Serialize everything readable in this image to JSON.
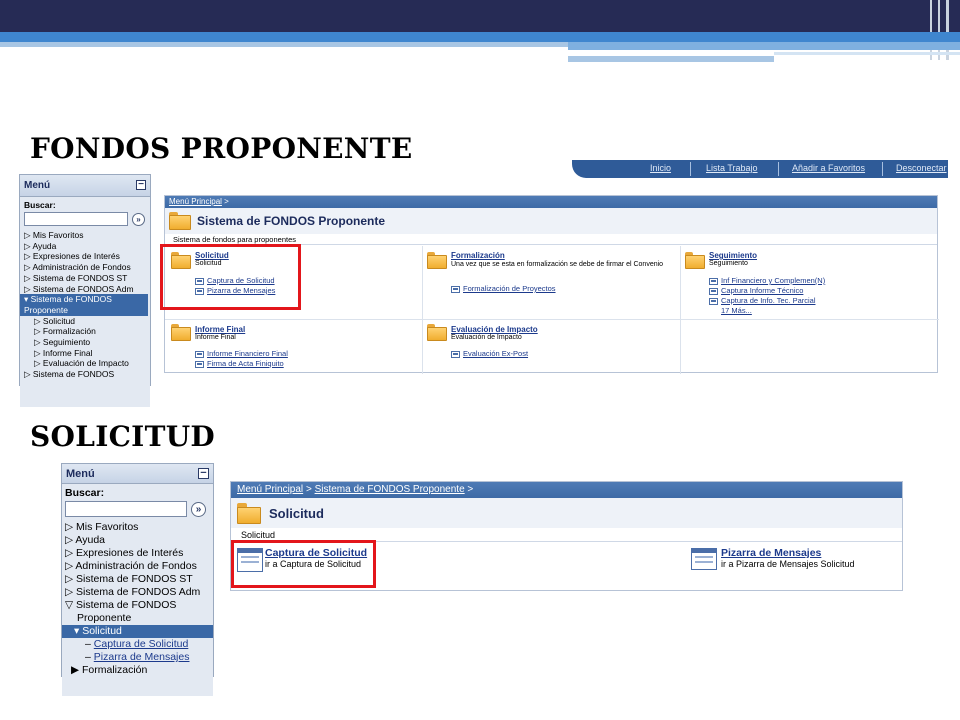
{
  "slide": {
    "heading_1": "FONDOS PROPONENTE",
    "heading_2": "SOLICITUD"
  },
  "colors": {
    "top_bar": "#262b55",
    "accent_blue": "#3f86cf",
    "highlight_red": "#e3161b",
    "menu_active": "#3a68a6",
    "breadcrumb": "#4f7bb5"
  },
  "screen1": {
    "header_links": [
      "Inicio",
      "Lista Trabajo",
      "Añadir a Favoritos",
      "Desconectar"
    ],
    "menu": {
      "title": "Menú",
      "search_label": "Buscar:",
      "search_value": "",
      "items": [
        {
          "label": "Mis Favoritos"
        },
        {
          "label": "Ayuda"
        },
        {
          "label": "Expresiones de Interés"
        },
        {
          "label": "Administración de Fondos"
        },
        {
          "label": "Sistema de FONDOS ST"
        },
        {
          "label": "Sistema de FONDOS Adm"
        },
        {
          "label": "Sistema de FONDOS Proponente"
        },
        {
          "label": "Solicitud"
        },
        {
          "label": "Formalización"
        },
        {
          "label": "Seguimiento"
        },
        {
          "label": "Informe Final"
        },
        {
          "label": "Evaluación de Impacto"
        },
        {
          "label": "Sistema de FONDOS"
        }
      ]
    },
    "breadcrumb": {
      "root": "Menú Principal",
      "sep": ">"
    },
    "title": "Sistema de FONDOS Proponente",
    "description": "Sistema de fondos para proponentes",
    "cells": [
      {
        "title": "Solicitud",
        "subtitle": "Solicitud",
        "links": [
          "Captura de Solicitud",
          "Pizarra de Mensajes"
        ]
      },
      {
        "title": "Formalización",
        "subtitle": "Una vez que se esta en formalización se debe de firmar el Convenio",
        "links": [
          "Formalización de Proyectos"
        ]
      },
      {
        "title": "Seguimiento",
        "subtitle": "Seguimiento",
        "links": [
          "Inf Financiero y Complemen(N)",
          "Captura Informe Técnico",
          "Captura de Info. Tec. Parcial"
        ],
        "more": "17 Más..."
      },
      {
        "title": "Informe Final",
        "subtitle": "Informe Final",
        "links": [
          "Informe Financiero Final",
          "Firma de Acta Finiquito"
        ]
      },
      {
        "title": "Evaluación de Impacto",
        "subtitle": "Evaluación de Impacto",
        "links": [
          "Evaluación Ex-Post"
        ]
      }
    ]
  },
  "screen2": {
    "menu": {
      "title": "Menú",
      "search_label": "Buscar:",
      "search_value": "",
      "items": [
        {
          "label": "Mis Favoritos"
        },
        {
          "label": "Ayuda"
        },
        {
          "label": "Expresiones de Interés"
        },
        {
          "label": "Administración de Fondos"
        },
        {
          "label": "Sistema de FONDOS ST"
        },
        {
          "label": "Sistema de FONDOS Adm"
        },
        {
          "label": "Sistema de FONDOS"
        },
        {
          "label": "Proponente"
        },
        {
          "label": "Solicitud"
        },
        {
          "label": "Captura de Solicitud"
        },
        {
          "label": "Pizarra de Mensajes"
        },
        {
          "label": "Formalización"
        }
      ]
    },
    "breadcrumb": {
      "root": "Menú Principal",
      "middle": "Sistema de FONDOS Proponente",
      "sep": ">"
    },
    "title": "Solicitud",
    "description": "Solicitud",
    "cards": [
      {
        "title": "Captura de Solicitud",
        "subtitle": "ir a Captura de Solicitud"
      },
      {
        "title": "Pizarra de Mensajes",
        "subtitle": "ir a Pizarra de Mensajes Solicitud"
      }
    ]
  }
}
